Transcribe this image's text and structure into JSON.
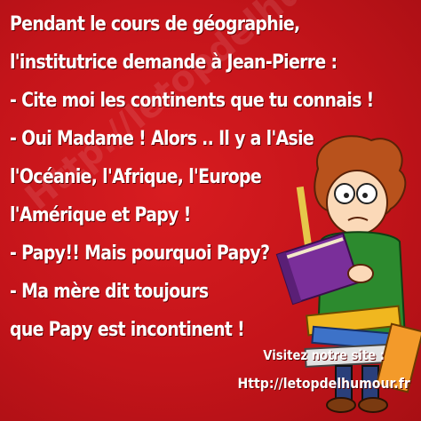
{
  "joke": {
    "lines": [
      "Pendant le cours de géographie,",
      "l'institutrice demande à Jean-Pierre :",
      "- Cite moi les continents que tu connais !",
      "- Oui Madame ! Alors .. Il y a l'Asie",
      "l'Océanie, l'Afrique, l'Europe",
      "l'Amérique et Papy !",
      "- Papy!! Mais pourquoi Papy?",
      "- Ma mère dit toujours",
      "que Papy est incontinent !"
    ]
  },
  "site": {
    "label": "Visitez notre site :",
    "url": "Http://letopdelhumour.fr"
  },
  "watermark": "Http://letopdelhumour.fr",
  "illustration": {
    "subject": "cartoon boy carrying a pile of books",
    "colors": {
      "background": "#c8141a",
      "hair": "#b8521c",
      "shirt": "#2c8a2e",
      "book": "#7a2f9a"
    }
  }
}
